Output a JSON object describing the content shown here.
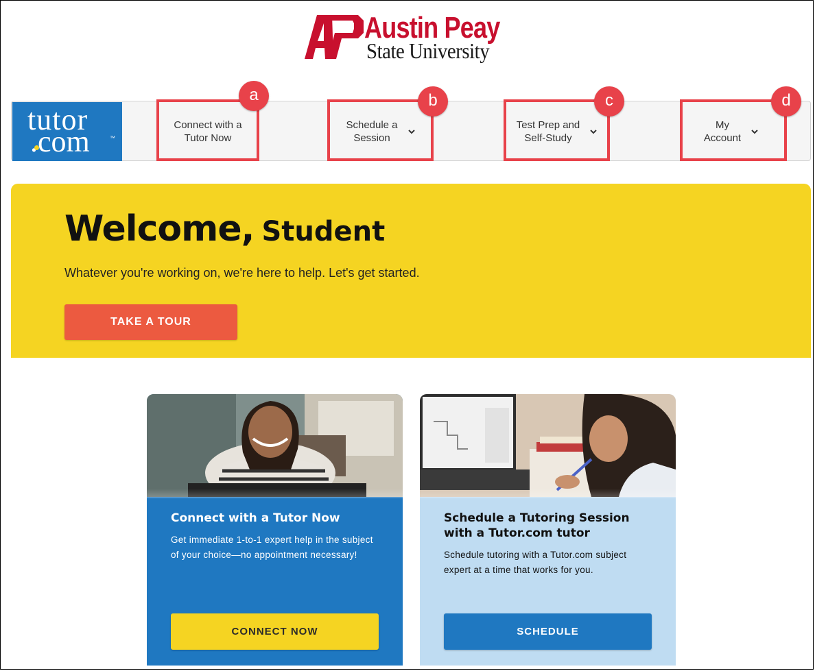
{
  "logo": {
    "university_line1": "Austin Peay",
    "university_line2": "State University",
    "mark_letters": "AP",
    "provider_line1": "tutor",
    "provider_line2": ".com",
    "provider_tm": "™"
  },
  "nav": {
    "items": [
      {
        "label_line1": "Connect with a",
        "label_line2": "Tutor Now",
        "badge": "a",
        "has_dropdown": false
      },
      {
        "label_line1": "Schedule a",
        "label_line2": "Session",
        "badge": "b",
        "has_dropdown": true
      },
      {
        "label_line1": "Test Prep and",
        "label_line2": "Self-Study",
        "badge": "c",
        "has_dropdown": true
      },
      {
        "label_line1": "My",
        "label_line2": "Account",
        "badge": "d",
        "has_dropdown": true
      }
    ]
  },
  "hero": {
    "greeting": "Welcome,",
    "name": "Student",
    "subtitle": "Whatever you're working on, we're here to help. Let's get started.",
    "tour_button": "TAKE A TOUR"
  },
  "cards": [
    {
      "title": "Connect with a Tutor Now",
      "body": "Get immediate 1-to-1 expert help in the subject of your choice—no appointment necessary!",
      "button": "CONNECT NOW"
    },
    {
      "title": "Schedule a Tutoring Session with a Tutor.com tutor",
      "body": "Schedule tutoring with a Tutor.com subject expert at a time that works for you.",
      "button": "SCHEDULE"
    }
  ],
  "colors": {
    "brand_blue": "#1f78c1",
    "hero_yellow": "#f5d422",
    "tour_orange": "#ec5a40",
    "annotation_red": "#e8424a",
    "apsu_red": "#c8102e",
    "card2_light_blue": "#bfdcf2"
  }
}
